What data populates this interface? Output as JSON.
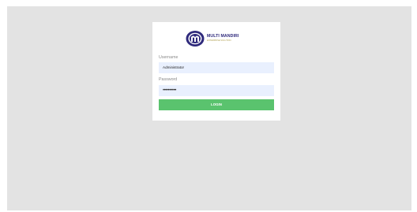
{
  "brand": {
    "name": "MULTI MANDIRI",
    "tagline": "ENTERPRISE SOLUTION"
  },
  "colors": {
    "brand_navy": "#2f2a7c",
    "input_bg": "#e9f0fe",
    "login_green": "#5ac36e",
    "page_bg": "#e3e3e3"
  },
  "form": {
    "username_label": "Username",
    "username_value": "Administrator",
    "password_label": "Password",
    "password_value": "••••••••••",
    "login_label": "LOGIN"
  }
}
